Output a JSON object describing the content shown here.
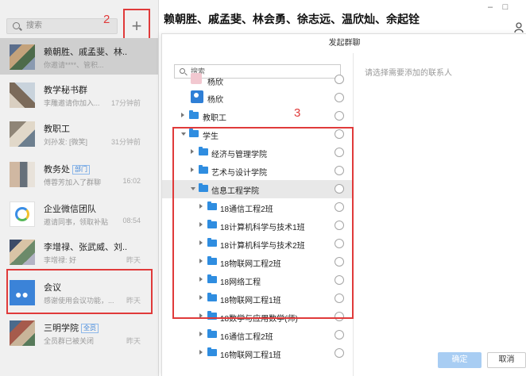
{
  "annotations": {
    "mark2": "2",
    "mark3": "3"
  },
  "left_panel": {
    "search_placeholder": "搜索",
    "plus_label": "+",
    "conversations": [
      {
        "name": "赖朝胜、戚孟斐、林...",
        "subtitle": "你邀请****、管积...",
        "time": "",
        "tag": ""
      },
      {
        "name": "教学秘书群",
        "subtitle": "李雕邀请你加入...",
        "time": "17分钟前",
        "tag": ""
      },
      {
        "name": "教职工",
        "subtitle": "刘孙发: [微笑]",
        "time": "31分钟前",
        "tag": ""
      },
      {
        "name": "教务处",
        "subtitle": "傅蓉芳加入了群聊",
        "time": "16:02",
        "tag": "部门"
      },
      {
        "name": "企业微信团队",
        "subtitle": "邀请同事，领取补贴",
        "time": "08:54",
        "tag": ""
      },
      {
        "name": "李增禄、张武威、刘...",
        "subtitle": "李增禄: 好",
        "time": "昨天",
        "tag": ""
      },
      {
        "name": "会议",
        "subtitle": "感谢使用会议功能，...",
        "time": "昨天",
        "tag": ""
      },
      {
        "name": "三明学院",
        "subtitle": "全员群已被关闭",
        "time": "昨天",
        "tag": "全员"
      }
    ]
  },
  "header": {
    "chat_title": "赖朝胜、戚孟斐、林会勇、徐志远、温欣灿、余起铨",
    "minimize": "–",
    "maximize": "□"
  },
  "dialog": {
    "title": "发起群聊",
    "search_placeholder": "搜索",
    "right_hint": "请选择需要添加的联系人",
    "confirm_label": "确定",
    "cancel_label": "取消",
    "tree": [
      {
        "label": "杨欣",
        "kind": "person"
      },
      {
        "label": "杨欣",
        "kind": "person"
      },
      {
        "label": "教职工",
        "kind": "folder"
      },
      {
        "label": "学生",
        "kind": "folder"
      },
      {
        "label": "经济与管理学院",
        "kind": "folder"
      },
      {
        "label": "艺术与设计学院",
        "kind": "folder"
      },
      {
        "label": "信息工程学院",
        "kind": "folder"
      },
      {
        "label": "18通信工程2班",
        "kind": "folder"
      },
      {
        "label": "18计算机科学与技术1班",
        "kind": "folder"
      },
      {
        "label": "18计算机科学与技术2班",
        "kind": "folder"
      },
      {
        "label": "18物联网工程2班",
        "kind": "folder"
      },
      {
        "label": "18网络工程",
        "kind": "folder"
      },
      {
        "label": "18物联网工程1班",
        "kind": "folder"
      },
      {
        "label": "18数学与应用数学(师)",
        "kind": "folder"
      },
      {
        "label": "16通信工程2班",
        "kind": "folder"
      },
      {
        "label": "16物联网工程1班",
        "kind": "folder"
      }
    ]
  }
}
